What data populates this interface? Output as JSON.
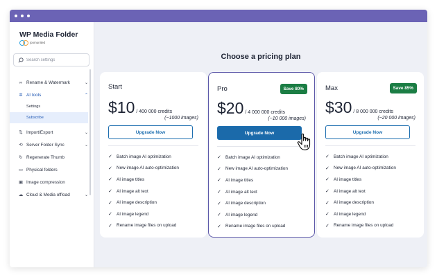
{
  "app": {
    "title": "WP Media Folder",
    "brand_sub": "joomunited"
  },
  "sidebar": {
    "search_placeholder": "Search settings",
    "items": [
      {
        "icon": "rename-icon",
        "label": "Rename & Watermark",
        "chevron": "⌄"
      },
      {
        "icon": "ai-sparkle-icon",
        "label": "AI tools",
        "chevron": "⌃"
      },
      {
        "icon": "import-export-icon",
        "label": "Import/Export",
        "chevron": "⌄"
      },
      {
        "icon": "server-sync-icon",
        "label": "Server Folder Sync",
        "chevron": "⌄"
      },
      {
        "icon": "regenerate-icon",
        "label": "Regenerate Thumb"
      },
      {
        "icon": "folder-icon",
        "label": "Physical folders"
      },
      {
        "icon": "image-compression-icon",
        "label": "Image compression"
      },
      {
        "icon": "cloud-icon",
        "label": "Cloud & Media offload",
        "chevron": "⌄"
      }
    ],
    "ai_subitems": [
      "Settings",
      "Subscribe"
    ]
  },
  "main": {
    "heading": "Choose a pricing plan",
    "plans": [
      {
        "name": "Start",
        "badge": "",
        "price": "$10",
        "credits": "/ 400 000 credits",
        "images": "(~1000 images)",
        "button": "Upgrade Now",
        "features": [
          "Batch image AI optimization",
          "New image AI auto-optimization",
          "AI image titles",
          "AI image alt text",
          "AI image description",
          "AI image legend",
          "Rename image files on upload"
        ]
      },
      {
        "name": "Pro",
        "badge": "Save 80%",
        "price": "$20",
        "credits": "/ 4 000 000 credits",
        "images": "(~10 000 images)",
        "button": "Upgrade Now",
        "features": [
          "Batch image AI optimization",
          "New image AI auto-optimization",
          "AI image titles",
          "AI image alt text",
          "AI image description",
          "AI image legend",
          "Rename image files on upload"
        ]
      },
      {
        "name": "Max",
        "badge": "Save 85%",
        "price": "$30",
        "credits": "/ 8 000 000 credits",
        "images": "(~20 000 images)",
        "button": "Upgrade Now",
        "features": [
          "Batch image AI optimization",
          "New image AI auto-optimization",
          "AI image titles",
          "AI image alt text",
          "AI image description",
          "AI image legend",
          "Rename image files on upload"
        ]
      }
    ]
  },
  "colors": {
    "titlebar": "#6b63b5",
    "accent_blue": "#1b6aaa",
    "badge_green": "#1b7d44",
    "pro_border": "#5b56a8"
  }
}
